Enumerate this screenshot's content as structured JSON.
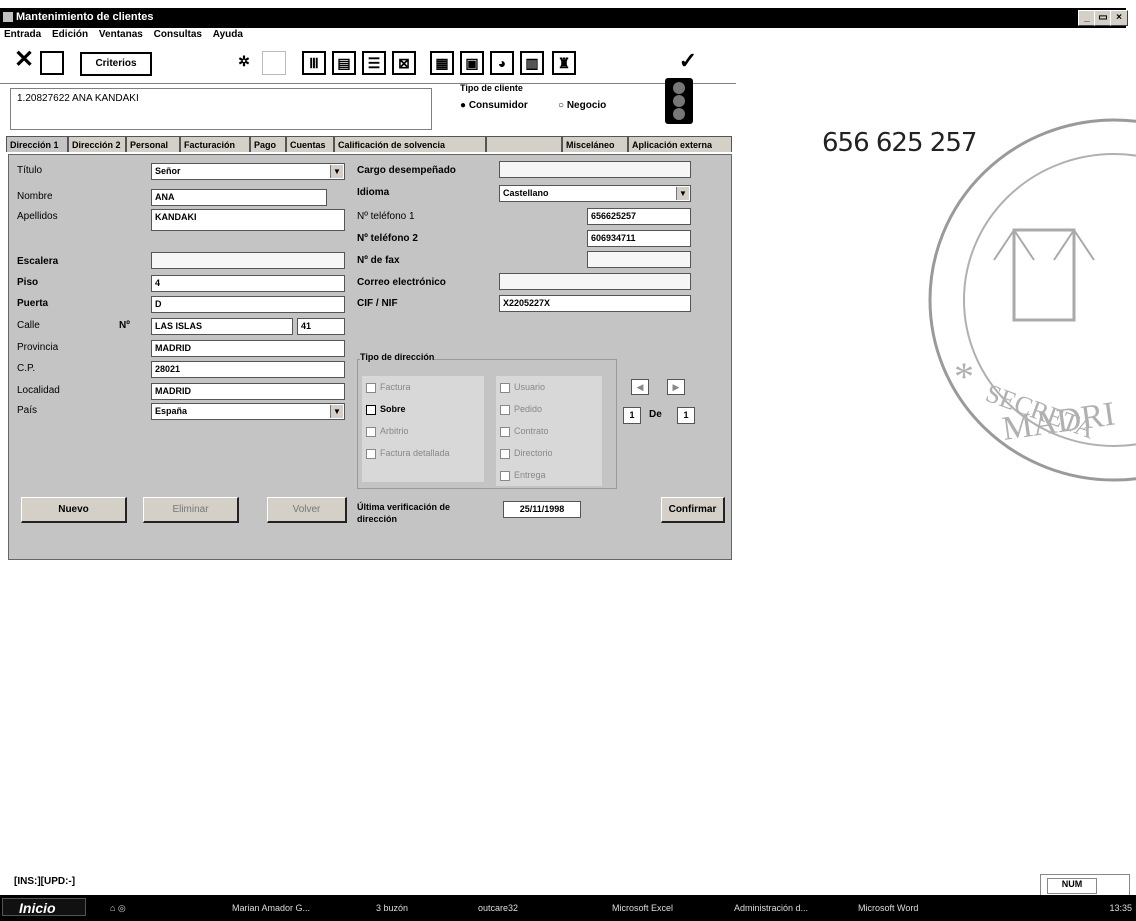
{
  "window": {
    "title": "Mantenimiento de clientes"
  },
  "menu": [
    "Entrada",
    "Edición",
    "Ventanas",
    "Consultas",
    "Ayuda"
  ],
  "toolbar": {
    "criterios_label": "Criterios"
  },
  "client": {
    "header": "1.20827622 ANA KANDAKI"
  },
  "tipo_cliente": {
    "label": "Tipo de cliente",
    "consumidor": "Consumidor",
    "negocio": "Negocio",
    "selected": "Consumidor"
  },
  "tabs": [
    "Dirección 1",
    "Dirección 2",
    "Personal",
    "Facturación",
    "Pago",
    "Cuentas",
    "Calificación de solvencia",
    "",
    "Misceláneo",
    "Aplicación externa"
  ],
  "form": {
    "titulo": {
      "label": "Título",
      "value": "Señor"
    },
    "nombre": {
      "label": "Nombre",
      "value": "ANA"
    },
    "apellidos": {
      "label": "Apellidos",
      "value": "KANDAKI"
    },
    "escalera": {
      "label": "Escalera",
      "value": ""
    },
    "piso": {
      "label": "Piso",
      "value": "4"
    },
    "puerta": {
      "label": "Puerta",
      "value": "D"
    },
    "calle": {
      "label": "Calle",
      "no_label": "Nº",
      "value": "LAS ISLAS",
      "numero": "41"
    },
    "provincia": {
      "label": "Provincia",
      "value": "MADRID"
    },
    "cp": {
      "label": "C.P.",
      "value": "28021"
    },
    "localidad": {
      "label": "Localidad",
      "value": "MADRID"
    },
    "pais": {
      "label": "País",
      "value": "España"
    },
    "cargo": {
      "label": "Cargo desempeñado",
      "value": ""
    },
    "idioma": {
      "label": "Idioma",
      "value": "Castellano"
    },
    "telefono1": {
      "label": "Nº teléfono 1",
      "value": "656625257"
    },
    "telefono2": {
      "label": "Nº teléfono 2",
      "value": "606934711"
    },
    "fax": {
      "label": "Nº de fax",
      "value": ""
    },
    "correo": {
      "label": "Correo electrónico",
      "value": ""
    },
    "cif": {
      "label": "CIF / NIF",
      "value": "X2205227X"
    }
  },
  "tipo_direccion": {
    "label": "Tipo de dirección",
    "left": [
      {
        "label": "Factura",
        "checked": true,
        "enabled": false
      },
      {
        "label": "Sobre",
        "checked": false,
        "enabled": true
      },
      {
        "label": "Arbitrio",
        "checked": true,
        "enabled": false
      },
      {
        "label": "Factura detallada",
        "checked": true,
        "enabled": false
      }
    ],
    "right": [
      {
        "label": "Usuario",
        "checked": true,
        "enabled": false
      },
      {
        "label": "Pedido",
        "checked": true,
        "enabled": false
      },
      {
        "label": "Contrato",
        "checked": true,
        "enabled": false
      },
      {
        "label": "Directorio",
        "checked": true,
        "enabled": false
      },
      {
        "label": "Entrega",
        "checked": true,
        "enabled": false
      }
    ]
  },
  "pager": {
    "current": "1",
    "de_label": "De",
    "total": "1"
  },
  "buttons": {
    "nuevo": "Nuevo",
    "eliminar": "Eliminar",
    "volver": "Volver",
    "confirmar": "Confirmar"
  },
  "verificacion": {
    "label": "Última verificación de dirección",
    "value": "25/11/1998"
  },
  "annotation": {
    "handwritten": "656 625 257"
  },
  "stamp": {
    "text": "JUZGADO CENTRAL DE INSTRUCCION NUMERO · FE PUBLICA JUDICIAL · SECRETARIA · MADRID"
  },
  "statusbar": {
    "left": "[INS:][UPD:-]",
    "num": "NUM"
  },
  "taskbar": {
    "start": "Inicio",
    "items": [
      "Marian Amador G...",
      "3 buzón",
      "outcare32",
      "Microsoft Excel",
      "Administración d...",
      "Microsoft Word"
    ],
    "clock": "13:35"
  },
  "colors": {
    "panel": "#c4c4c4",
    "titlebar": "#000000",
    "field": "#ffffff"
  }
}
